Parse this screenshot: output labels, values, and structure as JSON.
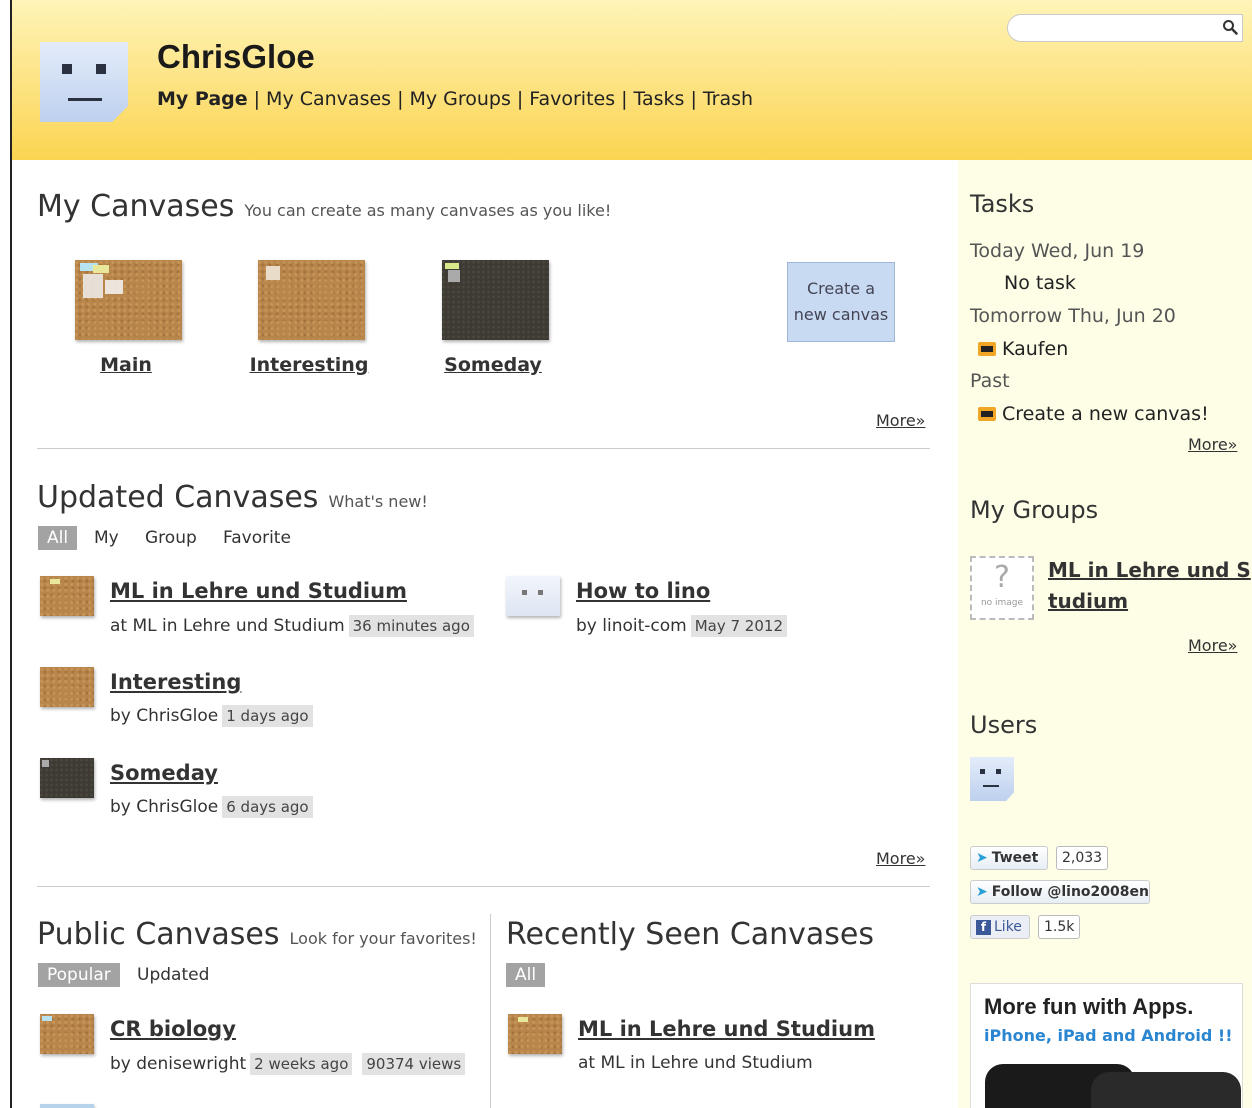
{
  "header": {
    "username": "ChrisGloe",
    "nav": [
      "My Page",
      "My Canvases",
      "My Groups",
      "Favorites",
      "Tasks",
      "Trash"
    ],
    "search_placeholder": ""
  },
  "my_canvases": {
    "title": "My Canvases",
    "subtitle": "You can create as many canvases as you like!",
    "canvases": [
      "Main",
      "Interesting",
      "Someday"
    ],
    "create_label": "Create a new canvas",
    "more": "More»"
  },
  "updated": {
    "title": "Updated Canvases",
    "subtitle": "What's new!",
    "filters": [
      "All",
      "My",
      "Group",
      "Favorite"
    ],
    "items": [
      {
        "title": "ML in Lehre und Studium",
        "meta": "at ML in Lehre und Studium",
        "time": "36 minutes ago"
      },
      {
        "title": "How to lino",
        "meta": "by linoit-com",
        "time": "May 7 2012"
      },
      {
        "title": "Interesting",
        "meta": "by ChrisGloe",
        "time": "1 days ago"
      },
      {
        "title": "Someday",
        "meta": "by ChrisGloe",
        "time": "6 days ago"
      }
    ],
    "more": "More»"
  },
  "public": {
    "title": "Public Canvases",
    "subtitle": "Look for your favorites!",
    "filters": [
      "Popular",
      "Updated"
    ],
    "items": [
      {
        "title": "CR biology",
        "meta": "by denisewright",
        "time": "2 weeks ago",
        "views": "90374 views"
      }
    ]
  },
  "recent": {
    "title": "Recently Seen Canvases",
    "filters": [
      "All"
    ],
    "items": [
      {
        "title": "ML in Lehre und Studium",
        "meta": "at ML in Lehre und Studium"
      }
    ]
  },
  "sidebar": {
    "tasks_title": "Tasks",
    "today": "Today Wed, Jun 19",
    "no_task": "No task",
    "tomorrow": "Tomorrow Thu, Jun 20",
    "tomorrow_task": "Kaufen",
    "past": "Past",
    "past_task": "Create a new canvas!",
    "tasks_more": "More»",
    "groups_title": "My Groups",
    "group_name_line1": "ML in Lehre und S",
    "group_name_line2": "tudium",
    "no_image": "no image",
    "groups_more": "More»",
    "users_title": "Users",
    "tweet": "Tweet",
    "tweet_count": "2,033",
    "follow": "Follow @lino2008en",
    "like": "Like",
    "like_count": "1.5k",
    "apps_title": "More fun with Apps.",
    "apps_sub": "iPhone, iPad and Android !!"
  },
  "colors": {
    "header": "#fbd551",
    "sidebar": "#fefde6",
    "tag": "#e2e2e2",
    "filter_selected": "#a3a3a3",
    "apps_link": "#2a86d0"
  }
}
